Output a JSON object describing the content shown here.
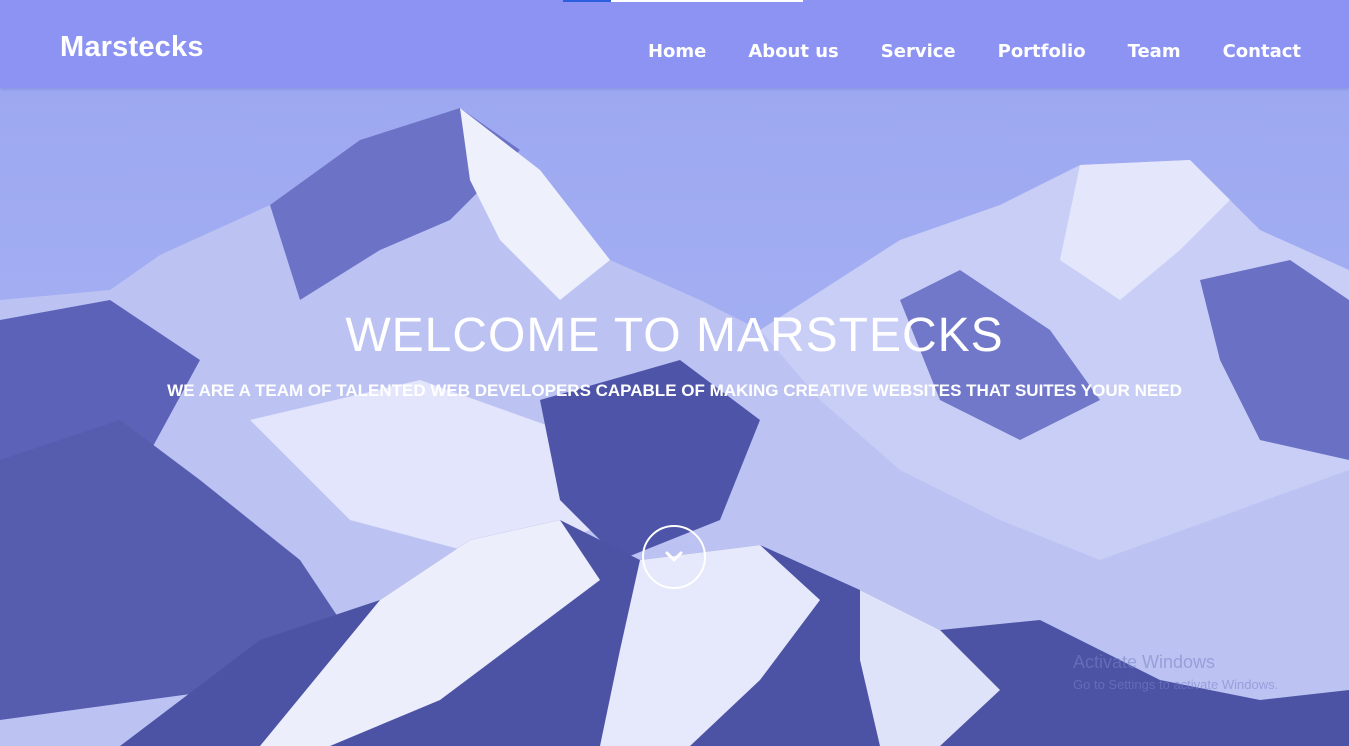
{
  "brand": {
    "name": "Marstecks"
  },
  "nav": {
    "items": [
      {
        "label": "Home"
      },
      {
        "label": "About us"
      },
      {
        "label": "Service"
      },
      {
        "label": "Portfolio"
      },
      {
        "label": "Team"
      },
      {
        "label": "Contact"
      }
    ],
    "scroll_progress_percent": 20
  },
  "hero": {
    "title": "WELCOME TO MARSTECKS",
    "subtitle": "WE ARE A TEAM OF TALENTED WEB DEVELOPERS CAPABLE OF MAKING CREATIVE WEBSITES THAT SUITES YOUR NEED",
    "scroll_icon": "chevron-down-icon"
  },
  "watermark": {
    "title": "Activate Windows",
    "subtitle": "Go to Settings to activate Windows."
  },
  "colors": {
    "navbar": "#8c93f3",
    "overlay": "#7f8ee8",
    "text": "#ffffff",
    "progress": "#2b5fe0"
  }
}
